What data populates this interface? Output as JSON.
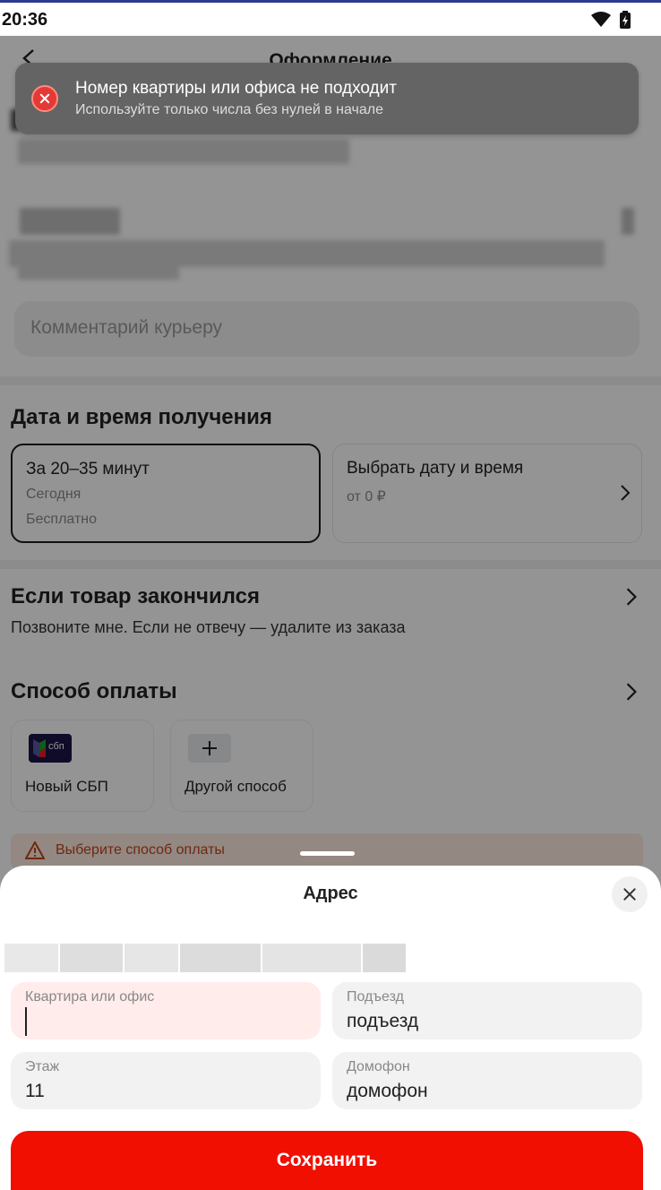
{
  "status_bar": {
    "time": "20:36"
  },
  "header": {
    "title": "Оформление"
  },
  "delivery": {
    "comment_placeholder": "Комментарий курьеру"
  },
  "datetime": {
    "section_title": "Дата и время получения",
    "options": [
      {
        "title": "За 20–35 минут",
        "line1": "Сегодня",
        "line2": "Бесплатно",
        "selected": true
      },
      {
        "title": "Выбрать дату и время",
        "line1": "от 0 ₽",
        "selected": false
      }
    ]
  },
  "out_of_stock": {
    "title": "Если товар закончился",
    "subtitle": "Позвоните мне. Если не отвечу — удалите из заказа"
  },
  "payment": {
    "title": "Способ оплаты",
    "methods": [
      {
        "label": "Новый СБП",
        "icon": "sbp-logo-icon",
        "logo_text": "сбп"
      },
      {
        "label": "Другой способ",
        "icon": "plus-icon"
      }
    ],
    "warning": "Выберите способ оплаты"
  },
  "toast": {
    "title": "Номер квартиры или офиса не подходит",
    "subtitle": "Используйте только числа без нулей в начале",
    "icon": "error-icon"
  },
  "address_sheet": {
    "title": "Адрес",
    "fields": {
      "apartment": {
        "label": "Квартира или офис",
        "value": ""
      },
      "entrance": {
        "label": "Подъезд",
        "value": "подъезд"
      },
      "floor": {
        "label": "Этаж",
        "value": "11"
      },
      "intercom": {
        "label": "Домофон",
        "value": "домофон"
      }
    },
    "save_label": "Сохранить"
  },
  "colors": {
    "accent": "#f00f00",
    "error_bg": "#ffeceb",
    "toast_bg": "#646464"
  }
}
